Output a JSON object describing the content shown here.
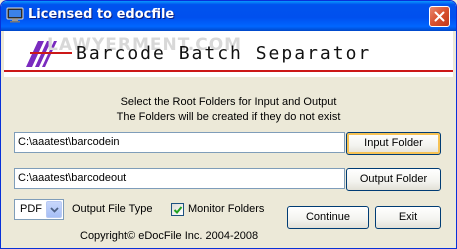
{
  "window": {
    "title": "Licensed to edocfile"
  },
  "banner": {
    "watermark": "LAWYERMENT.COM",
    "title": "Barcode Batch Separator"
  },
  "instructions": {
    "line1": "Select the Root Folders for Input and Output",
    "line2": "The Folders will be created if they do not exist"
  },
  "input_folder": {
    "value": "C:\\aaatest\\barcodein",
    "button_label": "Input Folder"
  },
  "output_folder": {
    "value": "C:\\aaatest\\barcodeout",
    "button_label": "Output Folder"
  },
  "options": {
    "file_type_selected": "PDF",
    "file_type_label": "Output File Type",
    "monitor_label": "Monitor Folders",
    "monitor_checked": true
  },
  "actions": {
    "continue_label": "Continue",
    "exit_label": "Exit"
  },
  "footer": {
    "copyright": "Copyright© eDocFile Inc. 2004-2008"
  },
  "colors": {
    "titlebar": "#0054e3",
    "accent_line": "#cc1818",
    "logo": "#7a2bbf",
    "default_button_ring": "#f6c254"
  }
}
